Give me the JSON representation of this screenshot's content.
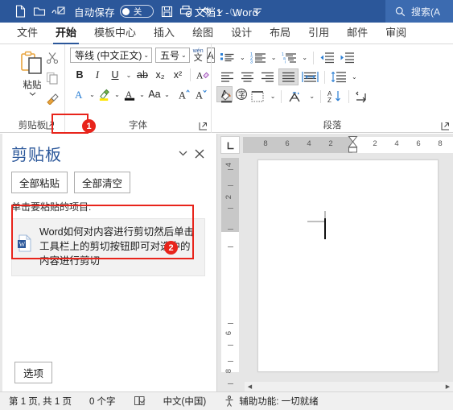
{
  "titlebar": {
    "autosave_label": "自动保存",
    "autosave_state": "关",
    "doc_title": "文档1  -  Word",
    "search_placeholder": "搜索(A",
    "qat_icons": [
      "new-document-icon",
      "open-folder-icon",
      "touch-mode-icon",
      "save-icon",
      "print-preview-icon",
      "undo-icon",
      "redo-icon",
      "customize-qat-icon"
    ]
  },
  "tabs": [
    {
      "label": "文件",
      "active": false
    },
    {
      "label": "开始",
      "active": true
    },
    {
      "label": "模板中心",
      "active": false
    },
    {
      "label": "插入",
      "active": false
    },
    {
      "label": "绘图",
      "active": false
    },
    {
      "label": "设计",
      "active": false
    },
    {
      "label": "布局",
      "active": false
    },
    {
      "label": "引用",
      "active": false
    },
    {
      "label": "邮件",
      "active": false
    },
    {
      "label": "审阅",
      "active": false
    }
  ],
  "ribbon": {
    "clipboard": {
      "group_label": "剪贴板",
      "paste_label": "粘贴",
      "cut_name": "cut-scissors-icon",
      "copy_name": "copy-icon",
      "format_painter_name": "format-painter-icon"
    },
    "font": {
      "group_label": "字体",
      "font_name": "等线 (中文正文)",
      "font_size": "五号",
      "phonetic_top": "wén",
      "phonetic_bottom": "文",
      "char_border": "A",
      "bold": "B",
      "italic": "I",
      "underline": "U",
      "strikethrough": "ab",
      "subscript": "x₂",
      "superscript": "x²",
      "clear_format": "A",
      "text_effects": "A",
      "highlight": "A",
      "font_color": "A",
      "change_case": "Aa",
      "grow_font": "A",
      "shrink_font": "A",
      "text_highlight_sel": "A",
      "enclose_char": "字"
    },
    "paragraph": {
      "group_label": "段落",
      "bullets": "bullet-list-icon",
      "numbering": "numbered-list-icon",
      "multilevel": "multilevel-list-icon",
      "dec_indent": "decrease-indent-icon",
      "inc_indent": "increase-indent-icon",
      "align_left": "align-left-icon",
      "align_center": "align-center-icon",
      "align_right": "align-right-icon",
      "justify": "justify-icon",
      "distribute": "distribute-icon",
      "line_spacing": "line-spacing-icon",
      "shading": "shading-icon",
      "borders": "borders-icon",
      "pinyin": "pinyin-guide-icon",
      "sort": "sort-az-icon",
      "show_marks": "show-formatting-marks-icon"
    }
  },
  "clipboard_pane": {
    "title": "剪贴板",
    "dropdown_icon": "chevron-down-icon",
    "close_icon": "close-icon",
    "paste_all": "全部粘贴",
    "clear_all": "全部清空",
    "hint": "单击要粘贴的项目:",
    "items": [
      {
        "icon": "word-document-icon",
        "text": "Word如何对内容进行剪切然后单击工具栏上的剪切按钮即可对选中的内容进行剪切"
      }
    ],
    "options_button": "选项"
  },
  "document": {
    "ruler_corner_icon": "tab-stop-left-icon",
    "h_ruler_numbers": [
      "8",
      "6",
      "4",
      "2",
      "2",
      "4",
      "6",
      "8"
    ],
    "v_ruler_numbers": [
      "4",
      "2",
      "6",
      "8"
    ],
    "scroll_left_icon": "scroll-left-arrow",
    "scroll_right_icon": "scroll-right-arrow"
  },
  "statusbar": {
    "page_info": "第 1 页, 共 1 页",
    "word_count": "0 个字",
    "proofing_icon": "proofing-icon",
    "language": "中文(中国)",
    "accessibility_icon": "accessibility-icon",
    "accessibility": "辅助功能: 一切就绪"
  },
  "annotations": [
    {
      "number": "1",
      "target": "clipboard-dialog-launcher"
    },
    {
      "number": "2",
      "target": "clipboard-item-1"
    }
  ],
  "colors": {
    "titlebar": "#2b579a",
    "accent": "#2b579a",
    "annotation": "#e8241b",
    "ribbon_bg": "#ffffff",
    "doc_bg": "#e6e6e6"
  }
}
